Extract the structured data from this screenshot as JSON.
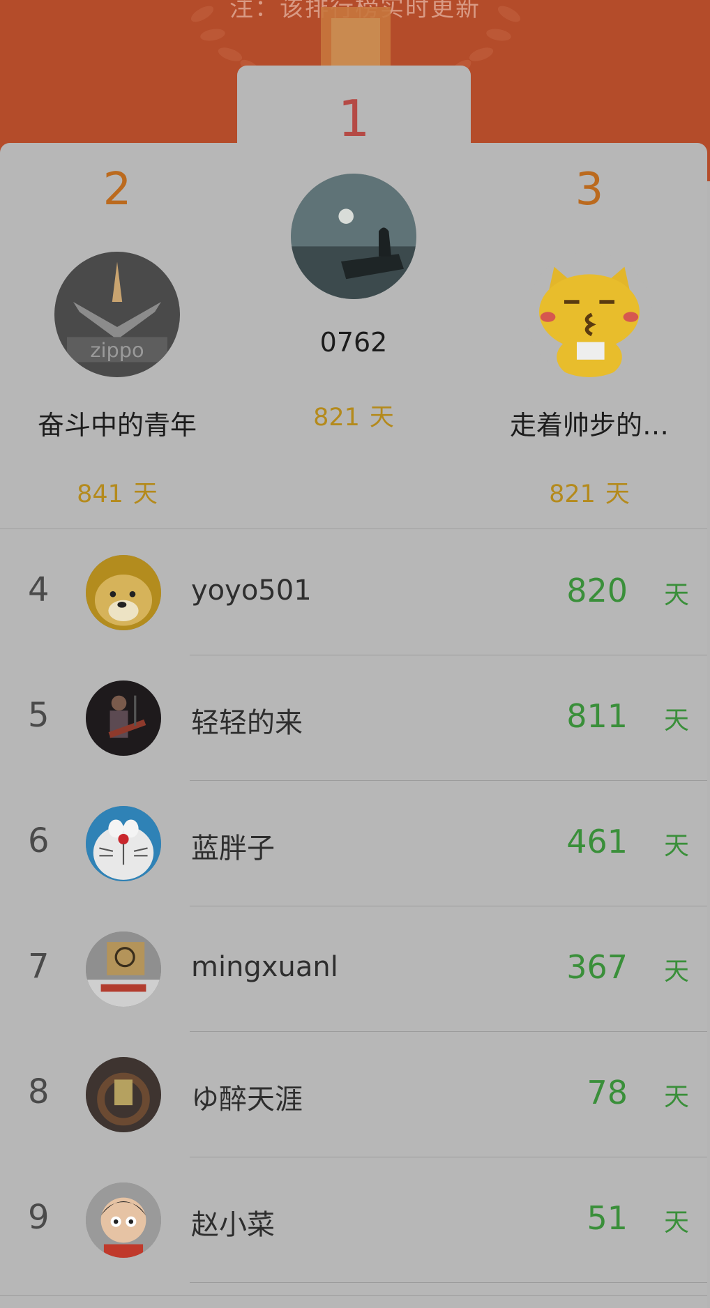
{
  "header": {
    "note": "注：该排行榜实时更新",
    "colors": {
      "banner": "#b44c2a",
      "panel": "#b7b7b7",
      "gold": "#b48a1c",
      "green": "#3a8f3a",
      "first": "#b54a45"
    }
  },
  "podium": {
    "first": {
      "rank": "1",
      "name": "0762",
      "days": "821",
      "unit": "天",
      "avatar": "silhouette-at-lake-avatar"
    },
    "second": {
      "rank": "2",
      "name": "奋斗中的青年",
      "days": "841",
      "unit": "天",
      "avatar": "zippo-lighter-avatar"
    },
    "third": {
      "rank": "3",
      "name": "走着帅步的…",
      "days": "821",
      "unit": "天",
      "avatar": "yellow-cat-cartoon-avatar"
    }
  },
  "list": [
    {
      "rank": "4",
      "name": "yoyo501",
      "days": "820",
      "unit": "天",
      "avatar": "doge-avatar"
    },
    {
      "rank": "5",
      "name": "轻轻的来",
      "days": "811",
      "unit": "天",
      "avatar": "guitarist-avatar"
    },
    {
      "rank": "6",
      "name": "蓝胖子",
      "days": "461",
      "unit": "天",
      "avatar": "doraemon-avatar"
    },
    {
      "rank": "7",
      "name": "mingxuanl",
      "days": "367",
      "unit": "天",
      "avatar": "lighter-box-avatar"
    },
    {
      "rank": "8",
      "name": "ゆ醉天涯",
      "days": "78",
      "unit": "天",
      "avatar": "gold-lighter-avatar"
    },
    {
      "rank": "9",
      "name": "赵小菜",
      "days": "51",
      "unit": "天",
      "avatar": "cartoon-boy-avatar"
    }
  ]
}
